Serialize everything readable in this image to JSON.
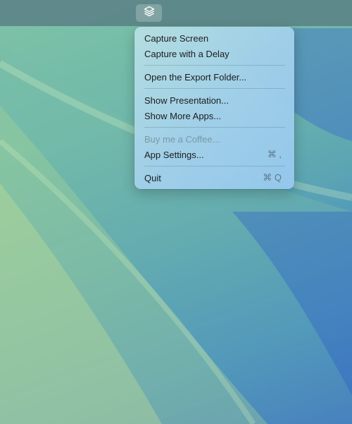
{
  "menubar": {
    "status_icon": "layers-icon"
  },
  "menu": {
    "items": [
      {
        "label": "Capture Screen",
        "shortcut": "",
        "enabled": true
      },
      {
        "label": "Capture with a Delay",
        "shortcut": "",
        "enabled": true
      },
      {
        "label": "Open the Export Folder...",
        "shortcut": "",
        "enabled": true
      },
      {
        "label": "Show Presentation...",
        "shortcut": "",
        "enabled": true
      },
      {
        "label": "Show More Apps...",
        "shortcut": "",
        "enabled": true
      },
      {
        "label": "Buy me a Coffee...",
        "shortcut": "",
        "enabled": false
      },
      {
        "label": "App Settings...",
        "shortcut": "⌘ ,",
        "enabled": true
      },
      {
        "label": "Quit",
        "shortcut": "⌘ Q",
        "enabled": true
      }
    ]
  },
  "colors": {
    "menubar": "#5c8488",
    "menu_text": "#1c1c1e",
    "disabled_text": "#7a98a6"
  }
}
